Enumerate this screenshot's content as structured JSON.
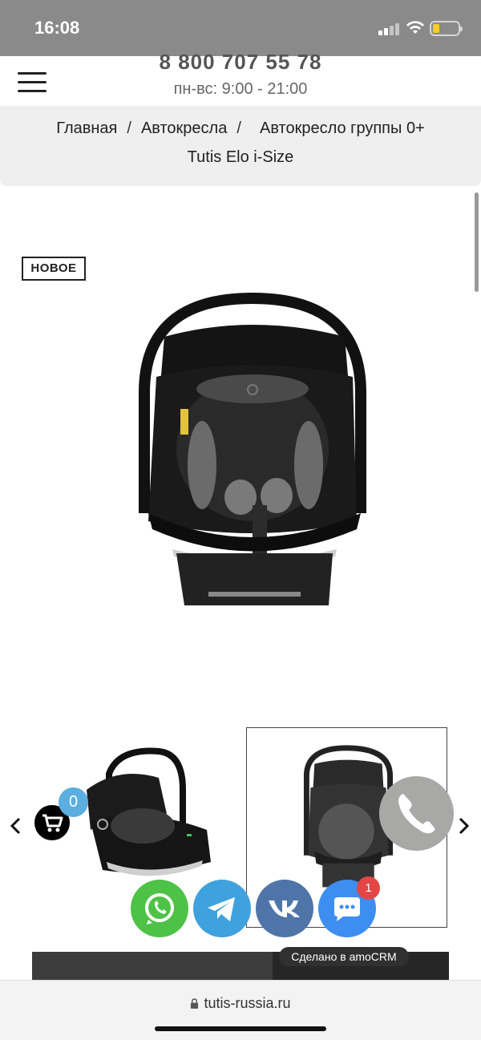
{
  "status_bar": {
    "time": "16:08",
    "battery_color": "#f5cc2e"
  },
  "header": {
    "phone": "8 800 707 55 78",
    "hours": "пн-вс: 9:00 - 21:00",
    "menu_icon": "hamburger-menu-icon"
  },
  "breadcrumb": {
    "home": "Главная",
    "category": "Автокресла",
    "current_line1": "Автокресло группы 0+",
    "current_line2": "Tutis Elo i-Size",
    "separator": "/"
  },
  "product": {
    "badge": "НОВОЕ",
    "main_image": "car-seat-image"
  },
  "gallery": {
    "prev_icon": "chevron-left-icon",
    "next_icon": "chevron-right-icon"
  },
  "floating": {
    "cart_count": "0",
    "cart_color": "#000000",
    "call_color": "#a8a8a6",
    "chat_badge": "1",
    "amocrm_label": "Сделано в amoCRM",
    "messengers": [
      "whatsapp-icon",
      "telegram-icon",
      "vk-icon",
      "chat-icon"
    ]
  },
  "browser": {
    "url": "tutis-russia.ru"
  }
}
